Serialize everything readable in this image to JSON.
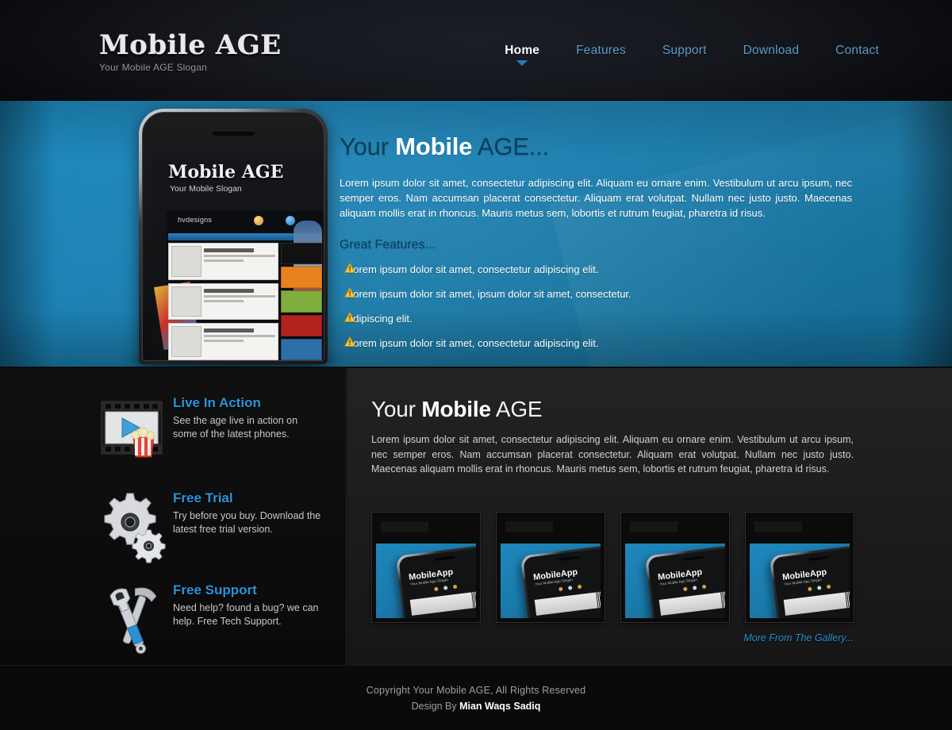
{
  "header": {
    "logo_title": "Mobile AGE",
    "logo_slogan": "Your Mobile AGE Slogan",
    "nav": [
      {
        "label": "Home",
        "active": true
      },
      {
        "label": "Features",
        "active": false
      },
      {
        "label": "Support",
        "active": false
      },
      {
        "label": "Download",
        "active": false
      },
      {
        "label": "Contact",
        "active": false
      }
    ]
  },
  "hero": {
    "title_pre": "Your ",
    "title_bold": "Mobile",
    "title_post": " AGE...",
    "paragraph": "Lorem ipsum dolor sit amet, consectetur adipiscing elit. Aliquam eu ornare enim. Vestibulum ut arcu ipsum, nec semper eros. Nam accumsan placerat consectetur. Aliquam erat volutpat. Nullam nec justo justo. Maecenas aliquam mollis erat in rhoncus. Mauris metus sem, lobortis et rutrum feugiat, pharetra id risus.",
    "subheading": "Great Features...",
    "features": [
      "Lorem ipsum dolor sit amet, consectetur adipiscing elit.",
      "Lorem ipsum dolor sit amet,  ipsum dolor sit amet, consectetur.",
      "adipiscing elit.",
      "Lorem ipsum dolor sit amet, consectetur adipiscing elit."
    ],
    "phone": {
      "screen_title": "Mobile AGE",
      "screen_slogan": "Your Mobile Slogan",
      "site_brand": "hvdesigns"
    }
  },
  "sidebar": {
    "features": [
      {
        "icon": "film-play-popcorn-icon",
        "title": "Live In Action",
        "desc": "See the age live in action on some of the latest phones."
      },
      {
        "icon": "gears-icon",
        "title": "Free Trial",
        "desc": "Try before you buy. Download the latest free trial version."
      },
      {
        "icon": "wrench-hammer-icon",
        "title": "Free Support",
        "desc": "Need help? found a bug? we can help. Free Tech Support."
      }
    ]
  },
  "main": {
    "title_pre": "Your ",
    "title_bold": "Mobile",
    "title_post": " AGE",
    "paragraph": "Lorem ipsum dolor sit amet, consectetur adipiscing elit. Aliquam eu ornare enim. Vestibulum ut arcu ipsum, nec semper eros. Nam accumsan placerat consectetur. Aliquam erat volutpat. Nullam nec justo justo. Maecenas aliquam mollis erat in rhoncus. Mauris metus sem, lobortis et rutrum feugiat, pharetra id risus.",
    "gallery": [
      {
        "caption": "MobileApp",
        "sub": "Your Mobile App Slogan"
      },
      {
        "caption": "MobileApp",
        "sub": "Your Mobile App Slogan"
      },
      {
        "caption": "MobileApp",
        "sub": "Your Mobile App Slogan"
      },
      {
        "caption": "MobileApp",
        "sub": "Your Mobile App Slogan"
      }
    ],
    "gallery_link": "More From The Gallery..."
  },
  "footer": {
    "copyright": "Copyright Your Mobile AGE, All Rights Reserved",
    "design_prefix": "Design By ",
    "designer": "Mian Waqs Sadiq"
  },
  "colors": {
    "accent_blue": "#2a94d8",
    "hero_blue": "#1a80b3",
    "nav_link": "#5c9fcb",
    "warning_yellow": "#f2c230"
  }
}
